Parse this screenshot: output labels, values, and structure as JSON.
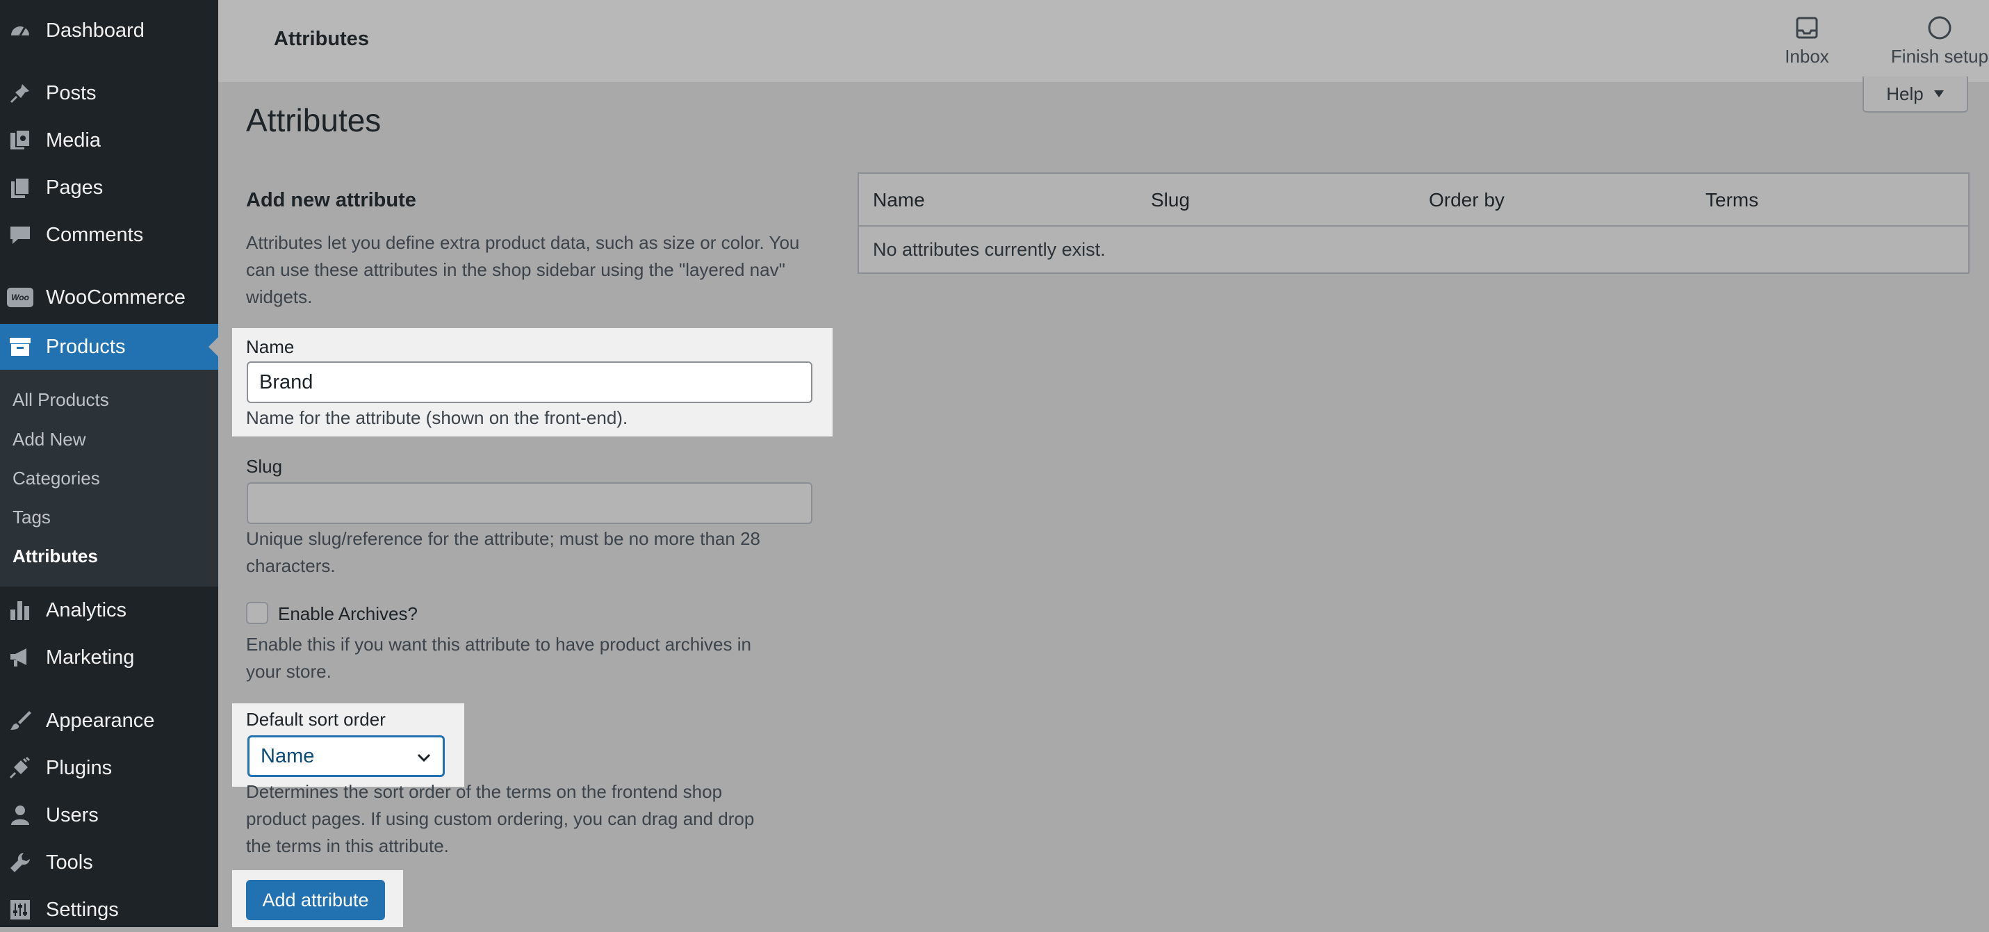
{
  "sidebar": {
    "menu": [
      {
        "label": "Dashboard",
        "icon": "dashboard-icon"
      },
      {
        "label": "Posts",
        "icon": "pin-icon"
      },
      {
        "label": "Media",
        "icon": "media-icon"
      },
      {
        "label": "Pages",
        "icon": "pages-icon"
      },
      {
        "label": "Comments",
        "icon": "comment-icon"
      },
      {
        "label": "WooCommerce",
        "icon": "woo-icon",
        "icon_text": "Woo"
      },
      {
        "label": "Products",
        "icon": "archive-icon"
      },
      {
        "label": "Analytics",
        "icon": "bar-chart-icon"
      },
      {
        "label": "Marketing",
        "icon": "megaphone-icon"
      },
      {
        "label": "Appearance",
        "icon": "brush-icon"
      },
      {
        "label": "Plugins",
        "icon": "plug-icon"
      },
      {
        "label": "Users",
        "icon": "user-icon"
      },
      {
        "label": "Tools",
        "icon": "wrench-icon"
      },
      {
        "label": "Settings",
        "icon": "sliders-icon"
      }
    ],
    "submenu": [
      {
        "label": "All Products"
      },
      {
        "label": "Add New"
      },
      {
        "label": "Categories"
      },
      {
        "label": "Tags"
      },
      {
        "label": "Attributes"
      }
    ]
  },
  "topbar": {
    "title": "Attributes",
    "inbox_label": "Inbox",
    "finish_setup_label": "Finish setup"
  },
  "help_label": "Help",
  "page_title": "Attributes",
  "form": {
    "heading": "Add new attribute",
    "intro_lines": [
      "Attributes let you define extra product data, such as size or color. You",
      "can use these attributes in the shop sidebar using the \"layered nav\"",
      "widgets."
    ],
    "name_label": "Name",
    "name_value": "Brand",
    "name_help": "Name for the attribute (shown on the front-end).",
    "slug_label": "Slug",
    "slug_value": "",
    "slug_help_lines": [
      "Unique slug/reference for the attribute; must be no more than 28",
      "characters."
    ],
    "archives_label": "Enable Archives?",
    "archives_help_lines": [
      "Enable this if you want this attribute to have product archives in",
      "your store."
    ],
    "sort_label": "Default sort order",
    "sort_value": "Name",
    "sort_help_lines": [
      "Determines the sort order of the terms on the frontend shop",
      "product pages. If using custom ordering, you can drag and drop",
      "the terms in this attribute."
    ],
    "submit_label": "Add attribute"
  },
  "table": {
    "columns": [
      "Name",
      "Slug",
      "Order by",
      "Terms"
    ],
    "empty_message": "No attributes currently exist."
  },
  "colors": {
    "sidebar_bg": "#1d2327",
    "accent": "#2271b1",
    "overlay_bg": "#a9a9a9"
  }
}
